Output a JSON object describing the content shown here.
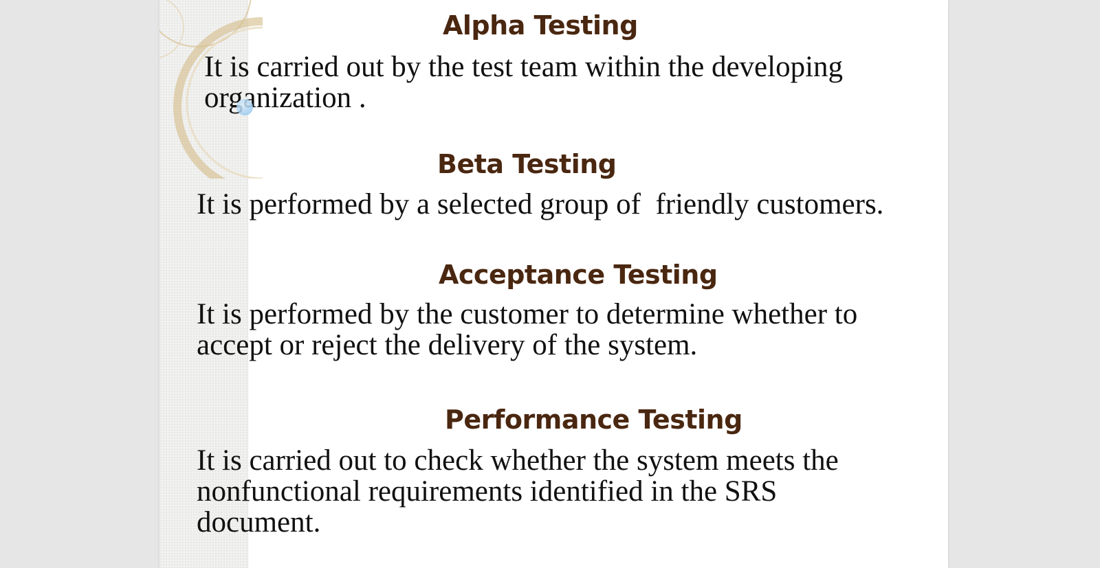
{
  "slide": {
    "sections": [
      {
        "heading": "Alpha Testing",
        "body": "It is carried out by the test team within the developing\norganization ."
      },
      {
        "heading": "Beta Testing",
        "body": "It is performed by a selected group of  friendly customers."
      },
      {
        "heading": "Acceptance Testing",
        "body": "It is performed by the customer to determine whether to\naccept or reject the delivery of the system."
      },
      {
        "heading": "Performance Testing",
        "body": "It is carried out to check whether the system meets the\nnonfunctional requirements identified in the SRS\ndocument."
      }
    ]
  },
  "colors": {
    "heading": "#4a2710",
    "body": "#111111",
    "background": "#e6e6e6",
    "slide": "#ffffff",
    "decoration": "#d9c69a"
  }
}
